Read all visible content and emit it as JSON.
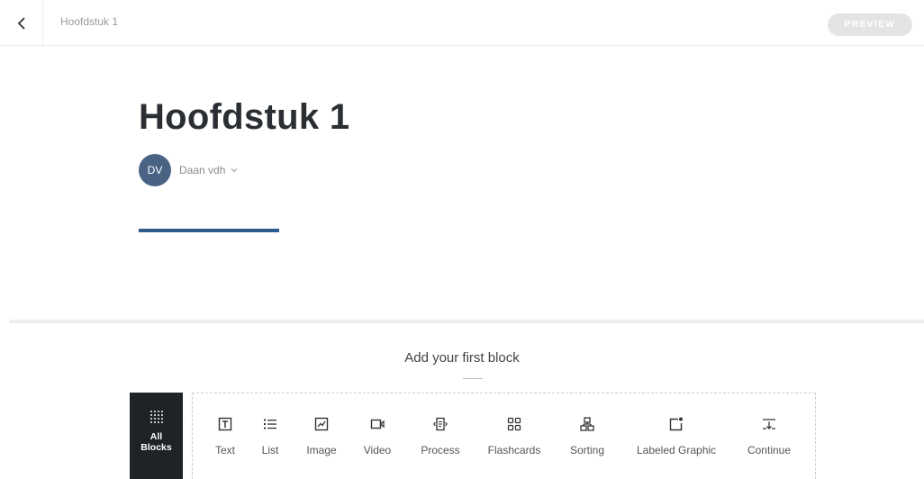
{
  "topbar": {
    "breadcrumb": "Hoofdstuk 1",
    "preview_label": "PREVIEW"
  },
  "lesson": {
    "title": "Hoofdstuk 1",
    "author_initials": "DV",
    "author_name": "Daan vdh"
  },
  "blocks": {
    "heading": "Add your first block",
    "all_blocks_label_1": "All",
    "all_blocks_label_2": "Blocks",
    "items": [
      {
        "label": "Text",
        "icon": "text-icon"
      },
      {
        "label": "List",
        "icon": "list-icon"
      },
      {
        "label": "Image",
        "icon": "image-icon"
      },
      {
        "label": "Video",
        "icon": "video-icon"
      },
      {
        "label": "Process",
        "icon": "process-icon"
      },
      {
        "label": "Flashcards",
        "icon": "flashcards-icon"
      },
      {
        "label": "Sorting",
        "icon": "sorting-icon"
      },
      {
        "label": "Labeled Graphic",
        "icon": "labeled-graphic-icon"
      },
      {
        "label": "Continue",
        "icon": "continue-icon"
      }
    ]
  },
  "colors": {
    "accent": "#2e5b8e",
    "avatar": "#4a6384",
    "dark_tile": "#1f2326",
    "preview_disabled": "#e4e4e4"
  }
}
